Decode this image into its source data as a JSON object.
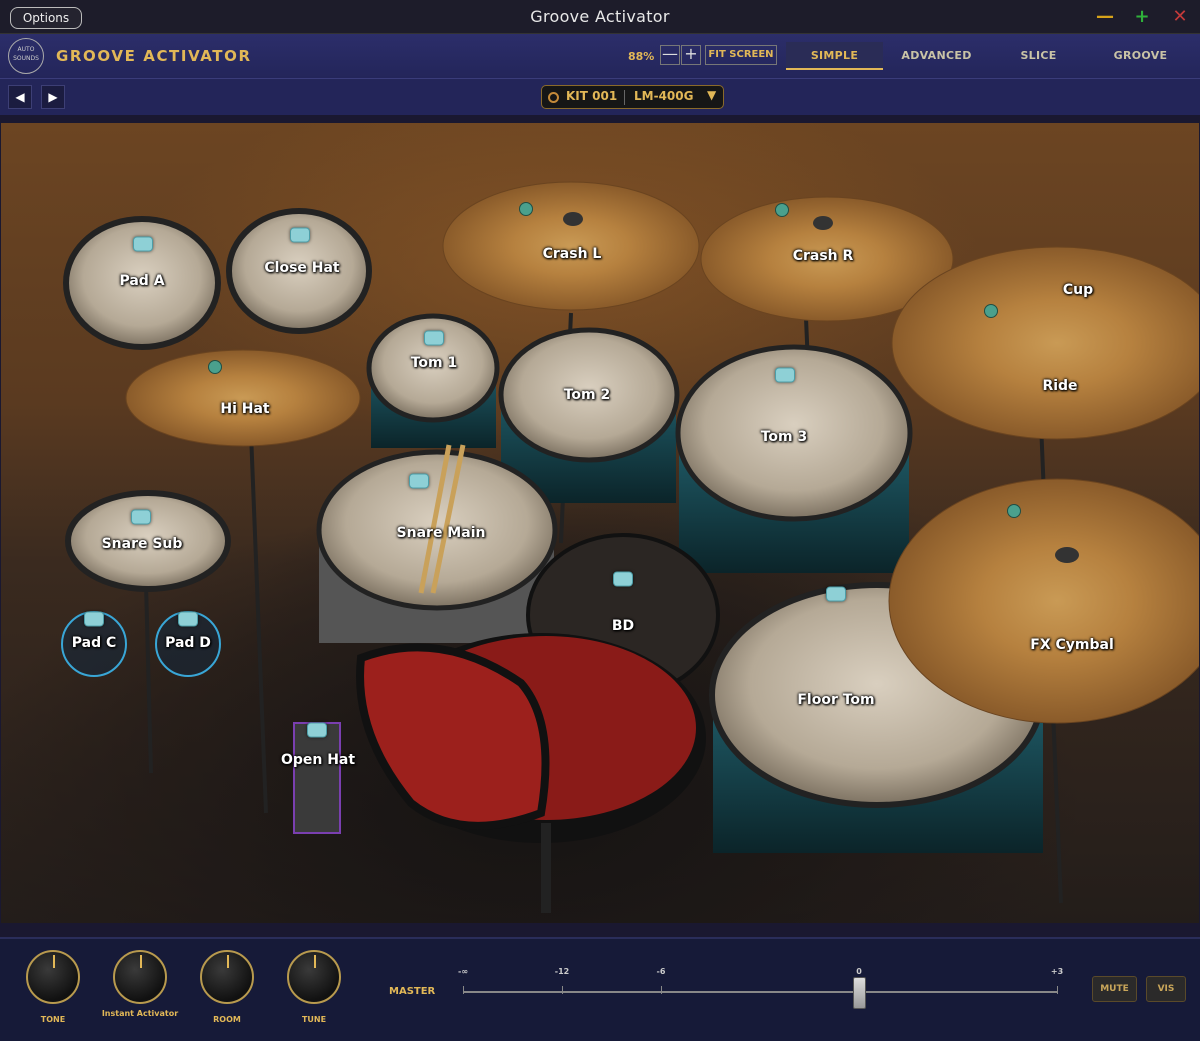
{
  "window": {
    "title": "Groove Activator",
    "options_label": "Options",
    "min_glyph": "—",
    "max_glyph": "+",
    "close_glyph": "✕"
  },
  "header": {
    "logo_text": "AUTO SOUNDS",
    "app_title": "GROOVE ACTIVATOR",
    "zoom": "88%",
    "zoom_minus": "—",
    "zoom_plus": "+",
    "fit_screen": "FIT SCREEN",
    "tabs": [
      {
        "label": "SIMPLE",
        "active": true
      },
      {
        "label": "ADVANCED",
        "active": false
      },
      {
        "label": "SLICE",
        "active": false
      },
      {
        "label": "GROOVE",
        "active": false
      }
    ]
  },
  "kitbar": {
    "prev_icon": "◀",
    "next_icon": "▶",
    "kit_number": "KIT 001",
    "kit_name": "LM-400G",
    "caret": "▼"
  },
  "kit_pieces": {
    "pad_a": "Pad A",
    "close_hat": "Close Hat",
    "crash_l": "Crash L",
    "crash_r": "Crash R",
    "cup": "Cup",
    "ride": "Ride",
    "tom_1": "Tom 1",
    "tom_2": "Tom 2",
    "tom_3": "Tom 3",
    "hi_hat": "Hi Hat",
    "snare_main": "Snare Main",
    "snare_sub": "Snare Sub",
    "bd": "BD",
    "pad_c": "Pad C",
    "pad_d": "Pad D",
    "open_hat": "Open Hat",
    "floor_tom": "Floor Tom",
    "fx_cymbal": "FX Cymbal"
  },
  "controls": {
    "knobs": [
      "TONE",
      "Instant Activator",
      "ROOM",
      "TUNE"
    ],
    "master_label": "MASTER",
    "scale": [
      "-∞",
      "-12",
      "-6",
      "0",
      "+3"
    ],
    "master_db": 0,
    "mute": "MUTE",
    "vis": "VIS"
  },
  "colors": {
    "accent": "#e2b857",
    "header_bg": "#2c2e6a",
    "pad_highlight": "#39a6d6"
  }
}
